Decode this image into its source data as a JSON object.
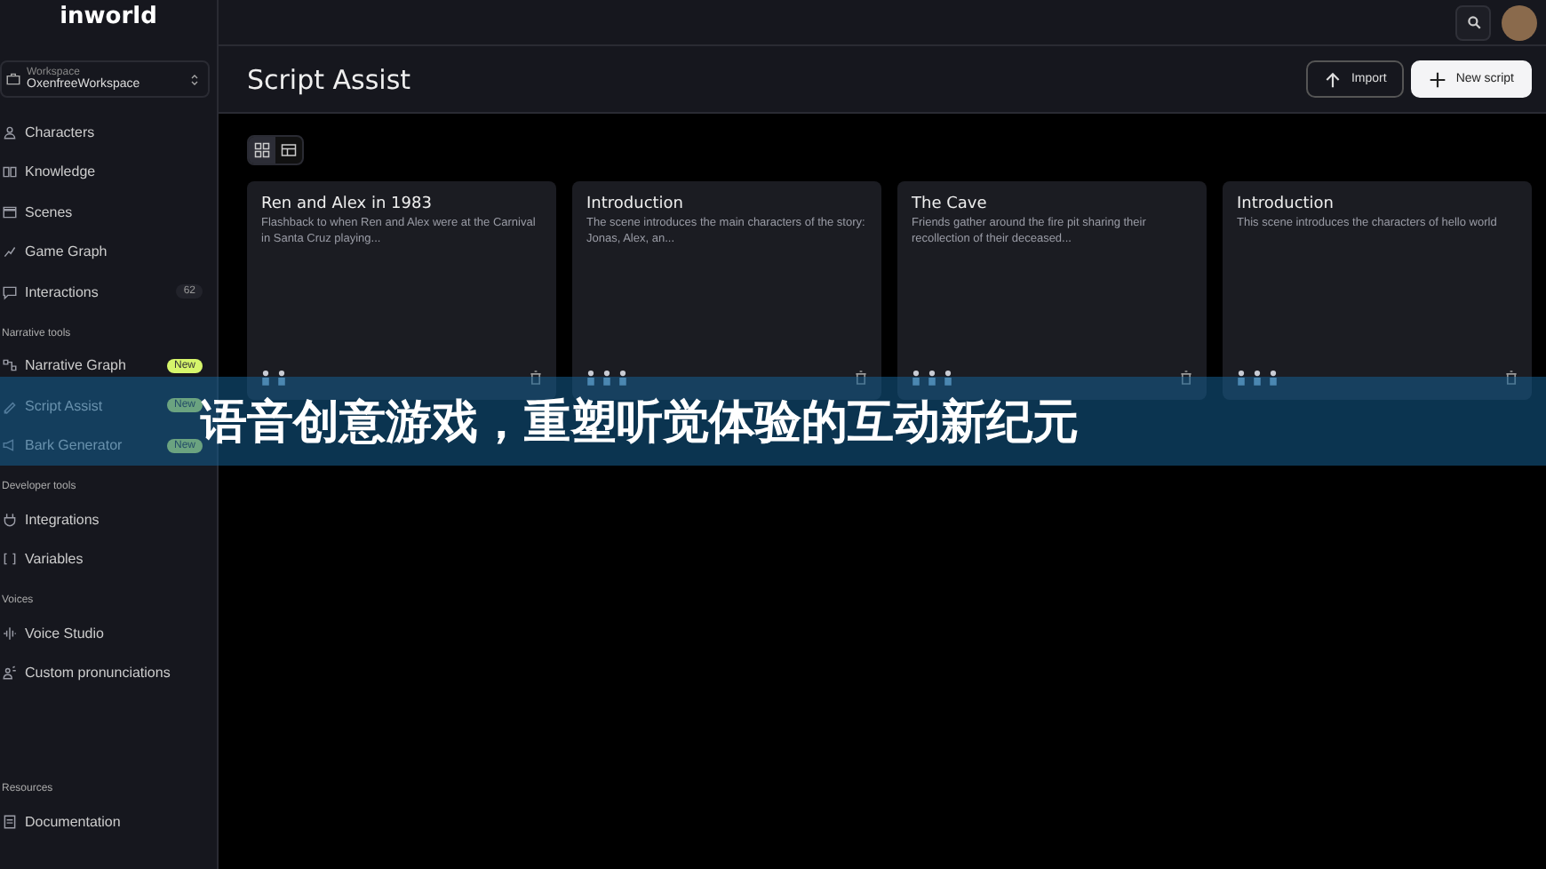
{
  "sidebar": {
    "logo": "inworld",
    "workspace": {
      "label": "Workspace",
      "value": "OxenfreeWorkspace"
    },
    "sections": [
      {
        "items": [
          {
            "label": "Characters"
          },
          {
            "label": "Knowledge"
          },
          {
            "label": "Scenes"
          },
          {
            "label": "Game Graph"
          },
          {
            "label": "Interactions",
            "count": "62"
          }
        ]
      },
      {
        "title": "Narrative tools",
        "items": [
          {
            "label": "Narrative Graph",
            "badge": "New"
          },
          {
            "label": "Script Assist",
            "badge": "New"
          },
          {
            "label": "Bark Generator",
            "badge": "New"
          }
        ]
      },
      {
        "title": "Developer tools",
        "items": [
          {
            "label": "Integrations"
          },
          {
            "label": "Variables"
          }
        ]
      },
      {
        "title": "Voices",
        "items": [
          {
            "label": "Voice Studio"
          },
          {
            "label": "Custom pronunciations"
          }
        ]
      },
      {
        "title": "Resources",
        "items": [
          {
            "label": "Documentation"
          }
        ]
      }
    ]
  },
  "header": {
    "title": "Script Assist",
    "buttons": [
      {
        "label": "Import",
        "kind": "import"
      },
      {
        "label": "New script",
        "kind": "new"
      }
    ]
  },
  "view_toggle": [
    {
      "kind": "grid",
      "selected": true
    },
    {
      "kind": "table",
      "selected": false
    }
  ],
  "cards": [
    {
      "title": "Ren and Alex in 1983",
      "description": "Flashback to when Ren and Alex were at the Carnival in Santa Cruz playing..."
    },
    {
      "title": "Introduction",
      "description": "The scene introduces the main characters of the story: Jonas, Alex, an..."
    },
    {
      "title": "The Cave",
      "description": "Friends gather around the fire pit sharing their recollection of their deceased..."
    },
    {
      "title": "Introduction",
      "description": "This scene introduces the characters of hello world"
    }
  ],
  "banner": {
    "text": "语音创意游戏，重塑听觉体验的互动新纪元"
  }
}
